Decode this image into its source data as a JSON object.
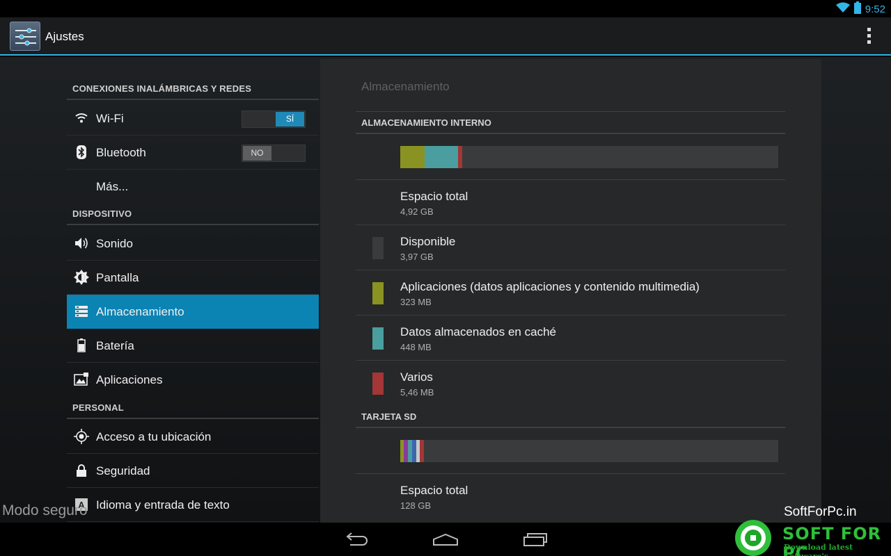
{
  "status_bar": {
    "time": "9:52",
    "wifi_icon": "wifi-icon",
    "battery_icon": "battery-icon"
  },
  "action_bar": {
    "title": "Ajustes",
    "app_icon": "settings-sliders-icon",
    "overflow_icon": "overflow-menu-icon"
  },
  "sidebar": {
    "sections": [
      {
        "header": "CONEXIONES INALÁMBRICAS Y REDES"
      },
      {
        "header": "DISPOSITIVO"
      },
      {
        "header": "PERSONAL"
      }
    ],
    "items": [
      {
        "label": "Wi-Fi",
        "icon": "wifi-icon",
        "toggle": "SÍ",
        "toggle_state": "on"
      },
      {
        "label": "Bluetooth",
        "icon": "bluetooth-icon",
        "toggle": "NO",
        "toggle_state": "off"
      },
      {
        "label": "Más...",
        "icon": ""
      },
      {
        "label": "Sonido",
        "icon": "speaker-icon"
      },
      {
        "label": "Pantalla",
        "icon": "brightness-icon"
      },
      {
        "label": "Almacenamiento",
        "icon": "storage-icon",
        "selected": true
      },
      {
        "label": "Batería",
        "icon": "battery-icon"
      },
      {
        "label": "Aplicaciones",
        "icon": "apps-icon"
      },
      {
        "label": "Acceso a tu ubicación",
        "icon": "location-icon"
      },
      {
        "label": "Seguridad",
        "icon": "lock-icon"
      },
      {
        "label": "Idioma y entrada de texto",
        "icon": "keyboard-a-icon"
      }
    ]
  },
  "main": {
    "title": "Almacenamiento",
    "internal": {
      "header": "ALMACENAMIENTO INTERNO",
      "usage_segments": [
        {
          "name": "Aplicaciones",
          "fraction": 0.064,
          "color": "#8a9222"
        },
        {
          "name": "Datos almacenados en caché",
          "fraction": 0.089,
          "color": "#4a9ea0"
        },
        {
          "name": "Varios",
          "fraction": 0.011,
          "color": "#a33636"
        }
      ],
      "rows": [
        {
          "title": "Espacio total",
          "value": "4,92 GB"
        },
        {
          "title": "Disponible",
          "value": "3,97 GB",
          "color": "#3a3b3d"
        },
        {
          "title": "Aplicaciones (datos aplicaciones y contenido multimedia)",
          "value": "323 MB",
          "color": "#8a9222"
        },
        {
          "title": "Datos almacenados en caché",
          "value": "448 MB",
          "color": "#4a9ea0"
        },
        {
          "title": "Varios",
          "value": "5,46 MB",
          "color": "#a33636"
        }
      ]
    },
    "sd": {
      "header": "TARJETA SD",
      "usage_segments": [
        {
          "fraction": 0.009,
          "color": "#8a9222"
        },
        {
          "fraction": 0.011,
          "color": "#8a3a9a"
        },
        {
          "fraction": 0.011,
          "color": "#4a9ea0"
        },
        {
          "fraction": 0.011,
          "color": "#3e66b0"
        },
        {
          "fraction": 0.009,
          "color": "#c9c9c9"
        },
        {
          "fraction": 0.011,
          "color": "#a33636"
        }
      ],
      "rows": [
        {
          "title": "Espacio total",
          "value": "128 GB"
        }
      ]
    }
  },
  "overlay": {
    "safe_mode": "Modo seguro"
  },
  "watermark": {
    "site": "SoftForPc.in",
    "brand": "SOFT FOR PC",
    "tagline": "Download latest Software's"
  },
  "nav_bar": {
    "back_icon": "back-icon",
    "home_icon": "home-icon",
    "recents_icon": "recents-icon"
  },
  "colors": {
    "accent": "#33b5e5",
    "selected": "#0b83b3"
  }
}
